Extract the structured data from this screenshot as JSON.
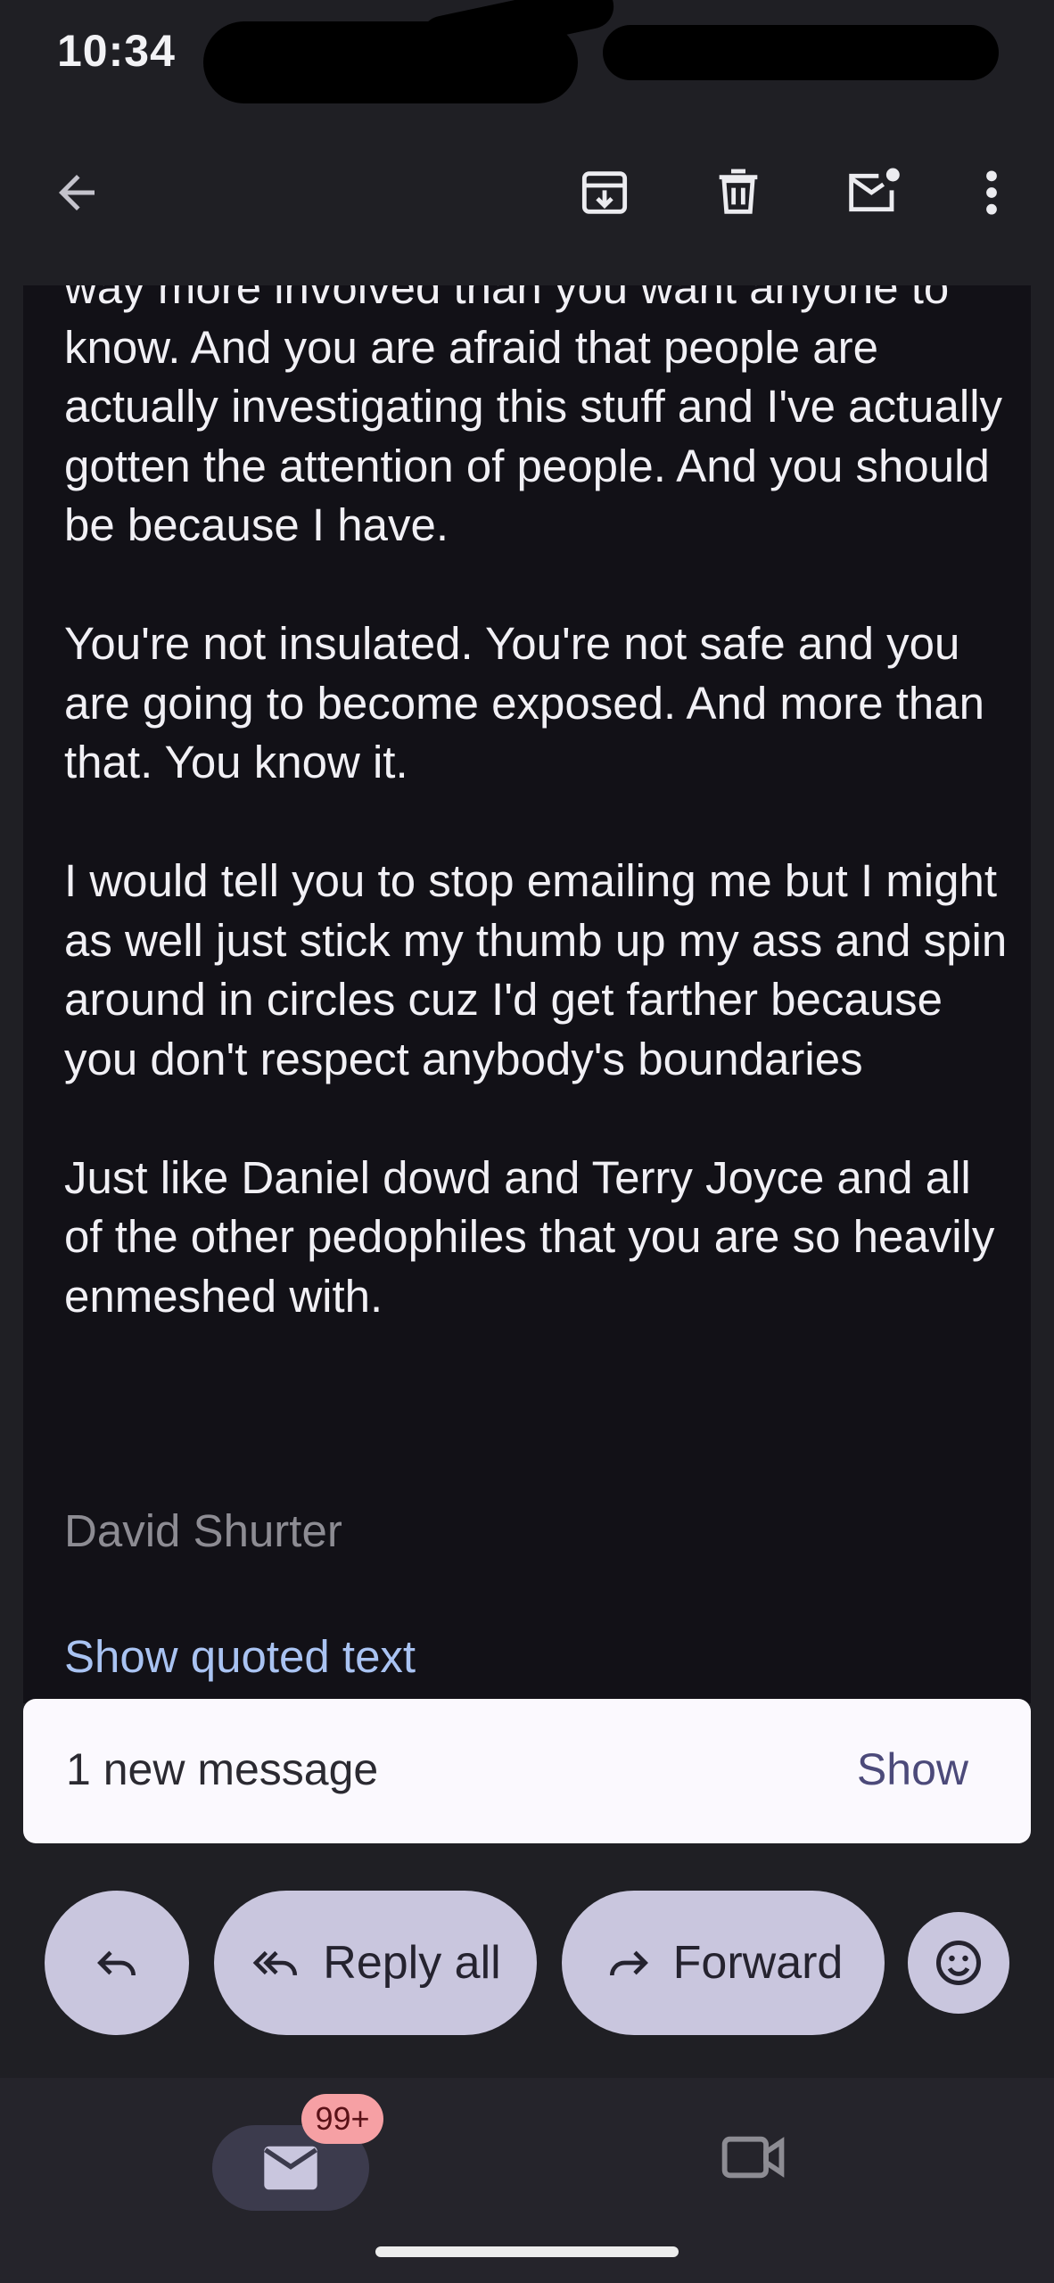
{
  "status_bar": {
    "time": "10:34"
  },
  "toolbar": {
    "back_icon": "arrow-back-icon",
    "archive_icon": "archive-icon",
    "delete_icon": "delete-icon",
    "mark_unread_icon": "mark-unread-icon",
    "more_icon": "more-vert-icon"
  },
  "message": {
    "paragraphs": [
      "way more involved than you want anyone to know. And you are afraid that people are actually investigating this stuff and I've actually gotten the attention of people. And you should be because I have.",
      "You're not insulated. You're not safe and you are going to become exposed. And more than that. You know it.",
      "I would tell you to stop emailing me but I might as well just stick my thumb up my ass and spin around in circles cuz I'd get farther because you don't respect anybody's boundaries",
      "Just like Daniel dowd and Terry Joyce and all of the other pedophiles that you are so heavily enmeshed with."
    ],
    "signature": "David Shurter",
    "show_quoted": "Show quoted text"
  },
  "snackbar": {
    "text": "1 new message",
    "action": "Show"
  },
  "actions": {
    "reply_icon": "reply-icon",
    "reply_all": "Reply all",
    "forward": "Forward",
    "emoji_icon": "emoji-reaction-icon"
  },
  "bottom_nav": {
    "mail_icon": "mail-icon",
    "mail_badge": "99+",
    "meet_icon": "video-camera-icon"
  },
  "colors": {
    "background": "#1f1f24",
    "message_background": "#121117",
    "button": "#c9c6de",
    "link": "#a9c3f2",
    "badge": "#f6a0a4"
  }
}
